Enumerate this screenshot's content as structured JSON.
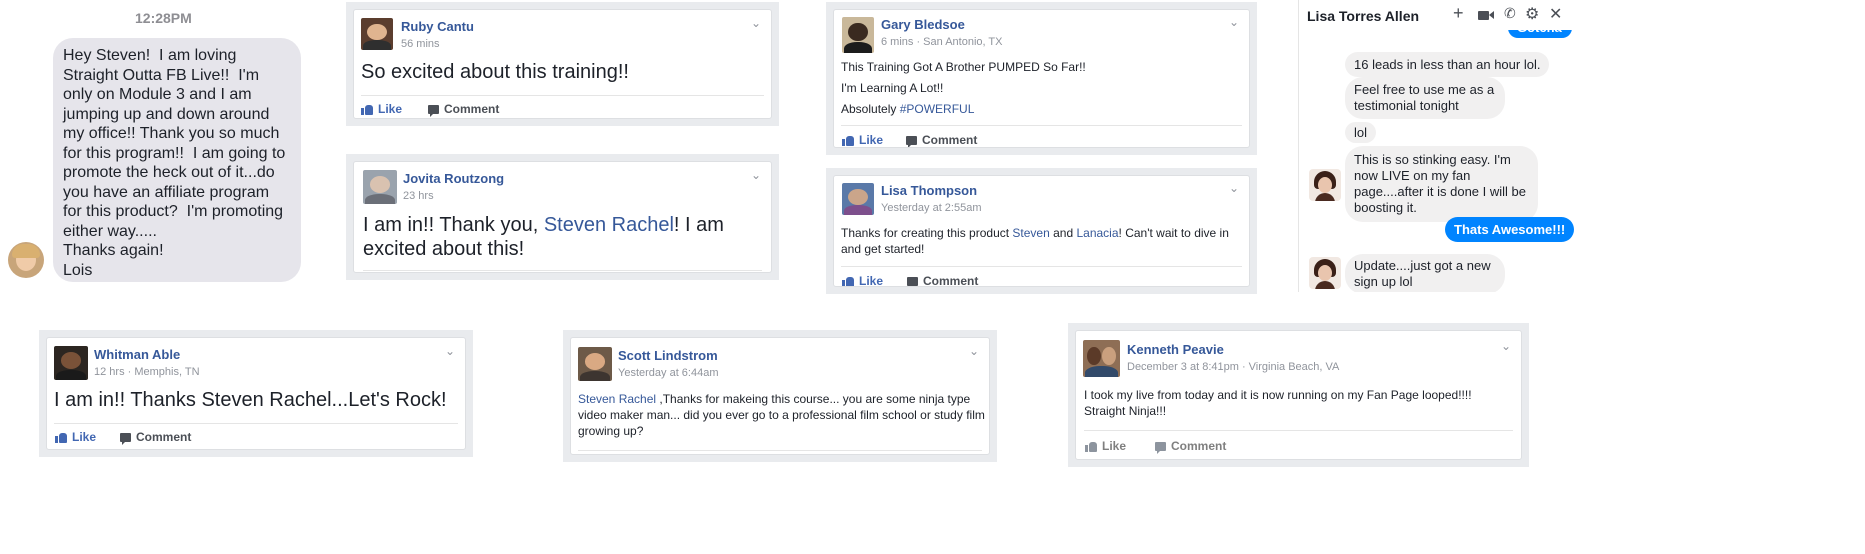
{
  "sms": {
    "time": "12:28PM",
    "message": "Hey Steven!  I am loving Straight Outta FB Live!!  I'm only on Module 3 and I am jumping up and down around my office!! Thank you so much for this program!!  I am going to promote the heck out of it...do you have an affiliate program for this product?  I'm promoting either way.....\nThanks again!\nLois"
  },
  "actions": {
    "like": "Like",
    "comment": "Comment"
  },
  "posts": {
    "ruby": {
      "name": "Ruby Cantu",
      "meta": "56 mins",
      "text": "So excited about this training!!"
    },
    "jovita": {
      "name": "Jovita Routzong",
      "meta": "23 hrs",
      "text_before": "I am in!! Thank you, ",
      "mention": "Steven Rachel",
      "text_after": "! I am excited about this!"
    },
    "gary": {
      "name": "Gary Bledsoe",
      "meta": "6 mins · San Antonio, TX",
      "line1": "This Training Got A Brother PUMPED So Far!!",
      "line2": "I'm Learning A Lot!!",
      "line3_prefix": "Absolutely ",
      "hashtag": "#POWERFUL"
    },
    "lisa_t": {
      "name": "Lisa Thompson",
      "meta": "Yesterday at 2:55am",
      "t1": "Thanks for creating this product ",
      "m1": "Steven",
      "t2": " and ",
      "m2": "Lanacia",
      "t3": "! Can't wait to dive in and get started!"
    },
    "whitman": {
      "name": "Whitman Able",
      "meta": "12 hrs · Memphis, TN",
      "text": "I am in!! Thanks Steven Rachel...Let's Rock!"
    },
    "scott": {
      "name": "Scott Lindstrom",
      "meta": "Yesterday at 6:44am",
      "mention": "Steven Rachel",
      "text": " ,Thanks for makeing this course... you are some ninja type video maker man... did you ever go to a professional film school or study film growing up?"
    },
    "kenneth": {
      "name": "Kenneth Peavie",
      "meta": "December 3 at 8:41pm · Virginia Beach, VA",
      "text": "I took my live from today and it is now running on my Fan Page looped!!!! Straight Ninja!!!"
    }
  },
  "chat": {
    "contact": "Lisa Torres Allen",
    "icons": [
      "plus-icon",
      "video-icon",
      "phone-icon",
      "gear-icon",
      "close-icon"
    ],
    "partial": "Gotcha",
    "m1": "16 leads in less than an hour lol.",
    "m2": "Feel free to use me as a testimonial tonight",
    "m3": "lol",
    "m4": "This is so stinking easy. I'm now LIVE on my fan page....after it is done I will be boosting it.",
    "m5": "Thats Awesome!!!",
    "m6": "Update....just got a new sign up lol"
  },
  "colors": {
    "fb_link": "#365899",
    "messenger_blue": "#0084ff",
    "card_frame": "#e9ebee"
  }
}
